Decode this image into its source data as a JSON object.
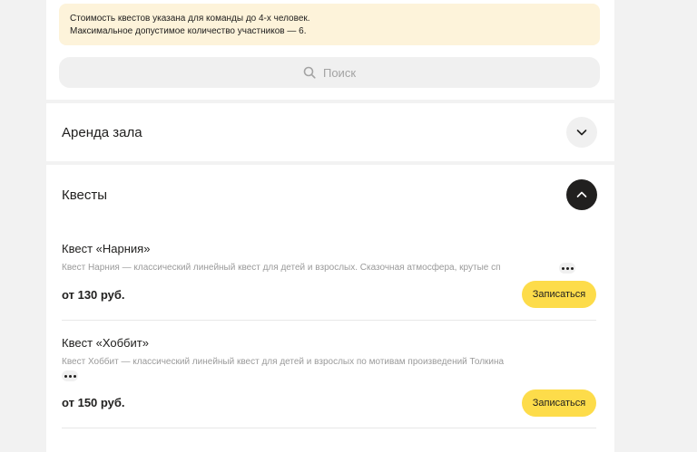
{
  "notice": {
    "line1": "Стоимость квестов указана для команды до 4-х человек.",
    "line2": "Максимальное допустимое количество участников — 6."
  },
  "search": {
    "placeholder": "Поиск",
    "icon": "search-icon"
  },
  "sections": {
    "hall": {
      "title": "Аренда зала",
      "toggle_icon": "chevron-down-icon",
      "expanded": false
    },
    "quests": {
      "title": "Квесты",
      "toggle_icon": "chevron-up-icon",
      "expanded": true
    }
  },
  "items": [
    {
      "title": "Квест «Нарния»",
      "description": "Квест Нарния — классический линейный квест для детей и взрослых. Сказочная атмосфера, крутые сп",
      "price": "от 130 руб.",
      "button": "Записаться"
    },
    {
      "title": "Квест «Хоббит»",
      "description": "Квест Хоббит — классический линейный квест для детей и взрослых по мотивам произведений Толкина",
      "price": "от 150 руб.",
      "button": "Записаться"
    }
  ],
  "colors": {
    "accent": "#fddc4a",
    "notice_bg": "#fdf3da",
    "text": "#21201f",
    "muted": "#9a9a9a"
  }
}
